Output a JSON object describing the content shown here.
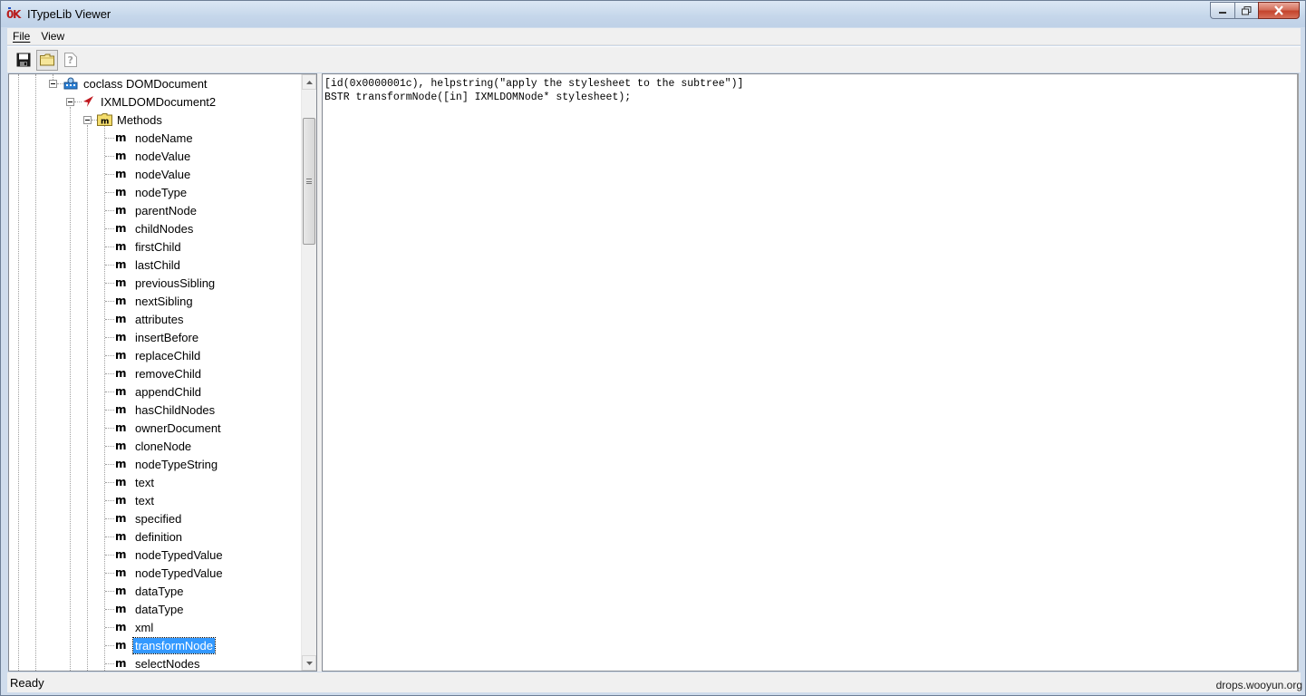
{
  "window": {
    "title": "ITypeLib Viewer",
    "controls": {
      "minimize": "minimize",
      "maximize": "maximize",
      "close": "close"
    }
  },
  "menubar": {
    "items": [
      {
        "label": "File",
        "accel": "F"
      },
      {
        "label": "View",
        "accel": "V"
      }
    ]
  },
  "toolbar": {
    "buttons": [
      {
        "name": "save",
        "icon": "floppy-disk-icon",
        "pressed": false
      },
      {
        "name": "open",
        "icon": "folder-icon",
        "pressed": true
      },
      {
        "name": "help",
        "icon": "help-question-icon",
        "pressed": false
      }
    ]
  },
  "tree": {
    "coclass": "coclass DOMDocument",
    "interface": "IXMLDOMDocument2",
    "methods_folder": "Methods",
    "method_icon_glyph": "m",
    "methods": [
      "nodeName",
      "nodeValue",
      "nodeValue",
      "nodeType",
      "parentNode",
      "childNodes",
      "firstChild",
      "lastChild",
      "previousSibling",
      "nextSibling",
      "attributes",
      "insertBefore",
      "replaceChild",
      "removeChild",
      "appendChild",
      "hasChildNodes",
      "ownerDocument",
      "cloneNode",
      "nodeTypeString",
      "text",
      "text",
      "specified",
      "definition",
      "nodeTypedValue",
      "nodeTypedValue",
      "dataType",
      "dataType",
      "xml",
      "transformNode",
      "selectNodes"
    ],
    "selected_index": 28
  },
  "detail": {
    "lines": [
      "[id(0x0000001c), helpstring(\"apply the stylesheet to the subtree\")]",
      "BSTR transformNode([in] IXMLDOMNode* stylesheet);"
    ]
  },
  "status": {
    "text": "Ready"
  },
  "watermark": "drops.wooyun.org",
  "colors": {
    "selection": "#3399ff",
    "interface_icon": "#c0181f",
    "coclass_icon": "#2a7fd4"
  }
}
